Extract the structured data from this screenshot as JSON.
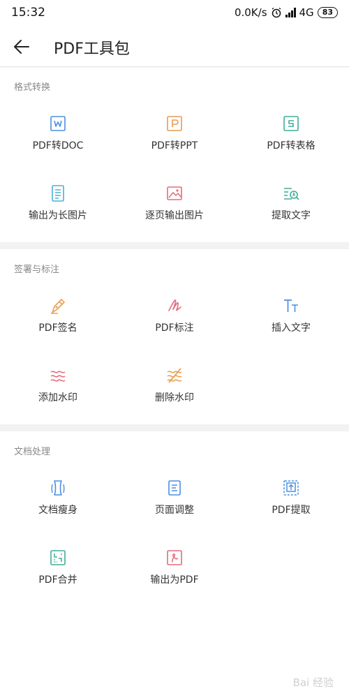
{
  "status_bar": {
    "time": "15:32",
    "speed": "0.0K/s",
    "network": "4G",
    "battery": "83",
    "icons": [
      "alarm-icon",
      "signal-icon",
      "battery-icon"
    ]
  },
  "header": {
    "title": "PDF工具包",
    "back_icon": "arrow-left-icon"
  },
  "sections": [
    {
      "title": "格式转换",
      "tools": [
        {
          "label": "PDF转DOC",
          "icon": "doc-w-icon",
          "color": "#4a8fe0"
        },
        {
          "label": "PDF转PPT",
          "icon": "ppt-p-icon",
          "color": "#e89a52"
        },
        {
          "label": "PDF转表格",
          "icon": "sheet-s-icon",
          "color": "#3fae9a"
        },
        {
          "label": "输出为长图片",
          "icon": "long-image-icon",
          "color": "#4ab0d9"
        },
        {
          "label": "逐页输出图片",
          "icon": "image-icon",
          "color": "#e56a7e"
        },
        {
          "label": "提取文字",
          "icon": "extract-text-icon",
          "color": "#3fae9a"
        }
      ]
    },
    {
      "title": "签署与标注",
      "tools": [
        {
          "label": "PDF签名",
          "icon": "pen-nib-icon",
          "color": "#e8a052"
        },
        {
          "label": "PDF标注",
          "icon": "scribble-icon",
          "color": "#e56a7e"
        },
        {
          "label": "插入文字",
          "icon": "text-t-icon",
          "color": "#4a8fe0"
        },
        {
          "label": "添加水印",
          "icon": "watermark-icon",
          "color": "#e56a7e"
        },
        {
          "label": "删除水印",
          "icon": "remove-watermark-icon",
          "color": "#e8a052"
        }
      ]
    },
    {
      "title": "文档处理",
      "tools": [
        {
          "label": "文档瘦身",
          "icon": "slim-doc-icon",
          "color": "#4a8fe0"
        },
        {
          "label": "页面调整",
          "icon": "page-adjust-icon",
          "color": "#4a8fe0"
        },
        {
          "label": "PDF提取",
          "icon": "pdf-extract-icon",
          "color": "#4a8fe0"
        },
        {
          "label": "PDF合并",
          "icon": "merge-icon",
          "color": "#3fae9a"
        },
        {
          "label": "输出为PDF",
          "icon": "export-pdf-icon",
          "color": "#e56a7e"
        }
      ]
    }
  ],
  "watermark": "Bai 经验"
}
